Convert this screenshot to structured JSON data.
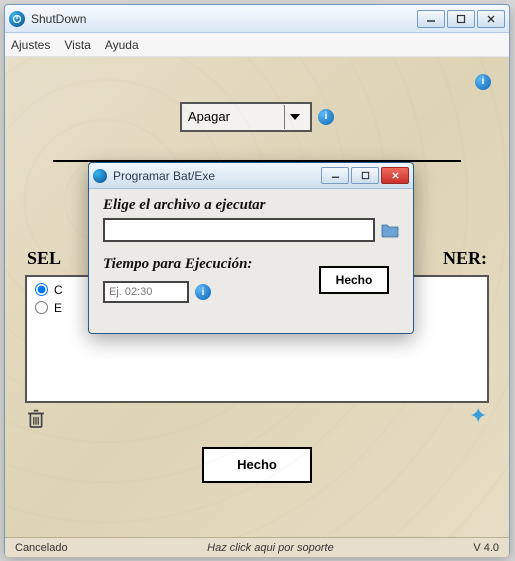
{
  "window": {
    "title": "ShutDown"
  },
  "menu": {
    "settings": "Ajustes",
    "view": "Vista",
    "help": "Ayuda"
  },
  "main": {
    "action_select": "Apagar",
    "sel_label_left": "SEL",
    "sel_label_right": "NER:",
    "done": "Hecho",
    "radio1": "C",
    "radio2": "E"
  },
  "status": {
    "left": "Cancelado",
    "center": "Haz click aqui por soporte",
    "right": "V 4.0"
  },
  "dialog": {
    "title": "Programar Bat/Exe",
    "file_label": "Elige el archivo a ejecutar",
    "file_value": "",
    "time_label": "Tiempo para Ejecución:",
    "time_placeholder": "Ej. 02:30",
    "done": "Hecho"
  }
}
